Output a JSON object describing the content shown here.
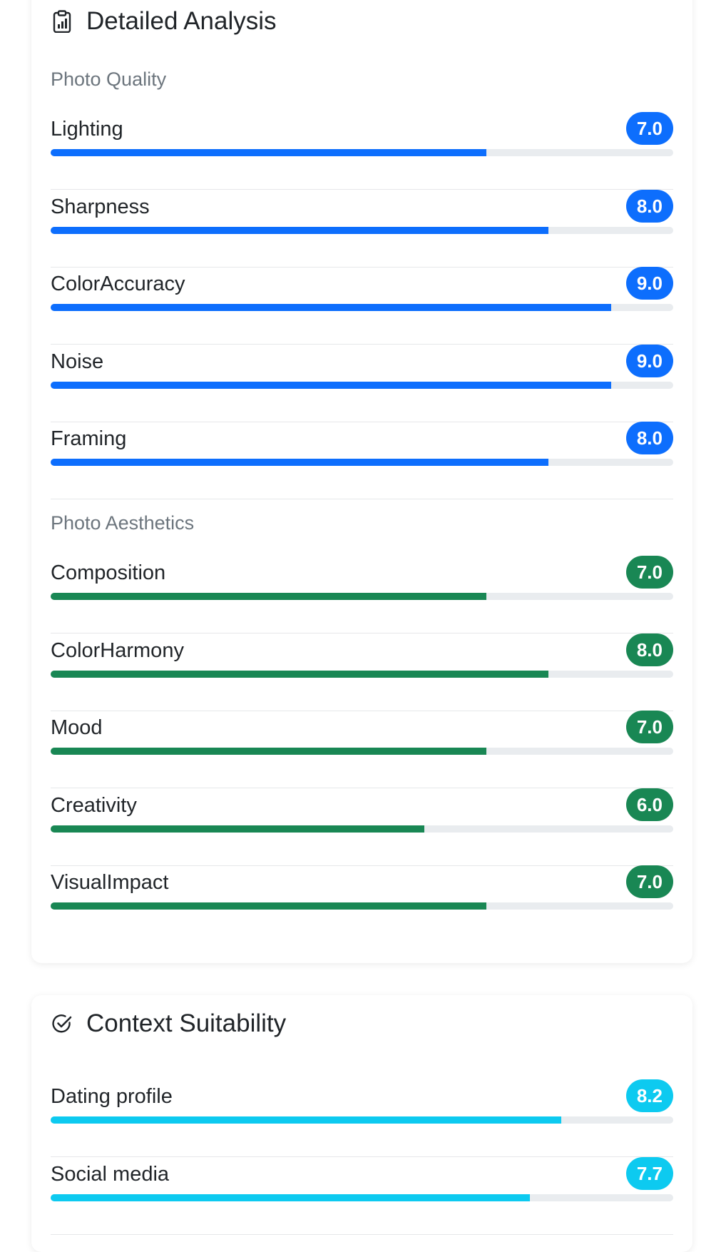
{
  "colors": {
    "quality": "#0d6efd",
    "aesthetics": "#198754",
    "context": "#0dcaf0"
  },
  "analysis": {
    "title": "Detailed Analysis",
    "icon": "clipboard-chart-icon",
    "sections": [
      {
        "label": "Photo Quality",
        "color": "quality",
        "metrics": [
          {
            "name": "Lighting",
            "score": "7.0",
            "value": 7.0
          },
          {
            "name": "Sharpness",
            "score": "8.0",
            "value": 8.0
          },
          {
            "name": "ColorAccuracy",
            "score": "9.0",
            "value": 9.0
          },
          {
            "name": "Noise",
            "score": "9.0",
            "value": 9.0
          },
          {
            "name": "Framing",
            "score": "8.0",
            "value": 8.0
          }
        ]
      },
      {
        "label": "Photo Aesthetics",
        "color": "aesthetics",
        "metrics": [
          {
            "name": "Composition",
            "score": "7.0",
            "value": 7.0
          },
          {
            "name": "ColorHarmony",
            "score": "8.0",
            "value": 8.0
          },
          {
            "name": "Mood",
            "score": "7.0",
            "value": 7.0
          },
          {
            "name": "Creativity",
            "score": "6.0",
            "value": 6.0
          },
          {
            "name": "VisualImpact",
            "score": "7.0",
            "value": 7.0
          }
        ]
      }
    ]
  },
  "context": {
    "title": "Context Suitability",
    "icon": "check-circle-icon",
    "color": "context",
    "metrics": [
      {
        "name": "Dating profile",
        "score": "8.2",
        "value": 8.2
      },
      {
        "name": "Social media",
        "score": "7.7",
        "value": 7.7
      }
    ]
  }
}
